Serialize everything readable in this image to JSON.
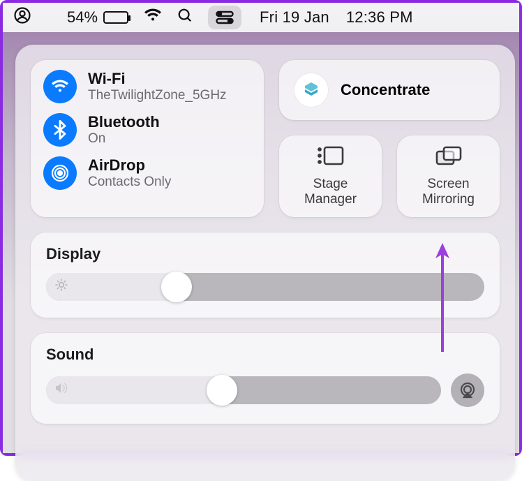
{
  "menubar": {
    "battery_percent": "54%",
    "date": "Fri 19 Jan",
    "time": "12:36 PM"
  },
  "connectivity": {
    "wifi": {
      "title": "Wi-Fi",
      "status": "TheTwilightZone_5GHz"
    },
    "bluetooth": {
      "title": "Bluetooth",
      "status": "On"
    },
    "airdrop": {
      "title": "AirDrop",
      "status": "Contacts Only"
    }
  },
  "focus": {
    "label": "Concentrate"
  },
  "tiles": {
    "stage_manager": "Stage\nManager",
    "screen_mirroring": "Screen\nMirroring"
  },
  "display": {
    "title": "Display",
    "value_percent": 33
  },
  "sound": {
    "title": "Sound",
    "value_percent": 48
  },
  "colors": {
    "accent_blue": "#0a7bff",
    "annotation": "#9b3fe0"
  }
}
